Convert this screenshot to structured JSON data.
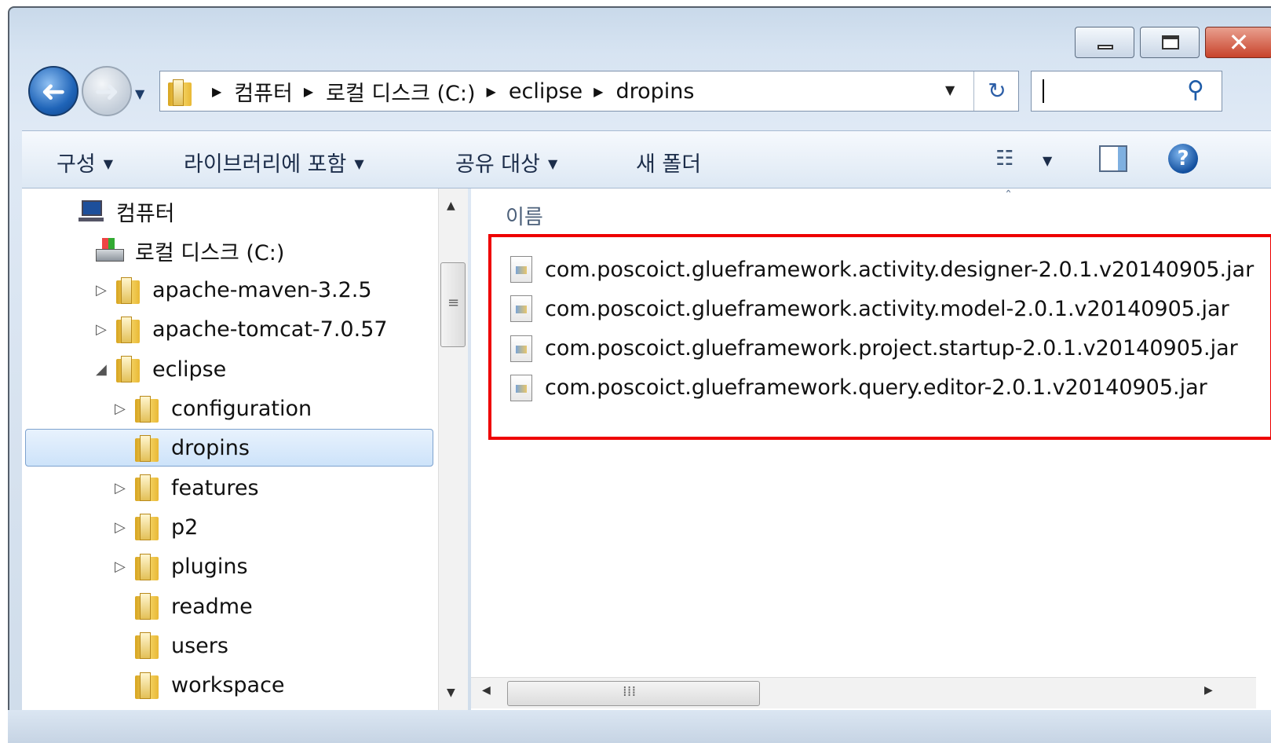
{
  "window": {
    "caption_buttons": {
      "close_glyph": "✕"
    }
  },
  "nav": {
    "back_glyph": "➜",
    "forward_glyph": "➜",
    "history_dropdown_glyph": "▼"
  },
  "address": {
    "breadcrumbs": [
      "컴퓨터",
      "로컬 디스크 (C:)",
      "eclipse",
      "dropins"
    ],
    "separator_glyph": "▶",
    "dropdown_glyph": "▼",
    "refresh_glyph": "↻"
  },
  "search": {
    "value": "",
    "icon_glyph": "⚲"
  },
  "toolbar": {
    "organize": "구성",
    "include_library": "라이브러리에 포함",
    "share_with": "공유 대상",
    "new_folder": "새 폴더",
    "dropdown_glyph": "▼",
    "view_icon_glyph": "☷",
    "help_glyph": "?"
  },
  "tree": {
    "items": [
      {
        "label": "컴퓨터",
        "level": 0,
        "icon": "computer-icon",
        "expander": ""
      },
      {
        "label": "로컬 디스크 (C:)",
        "level": 1,
        "icon": "drive-icon",
        "expander": ""
      },
      {
        "label": "apache-maven-3.2.5",
        "level": 2,
        "icon": "folder-icon",
        "expander": "▷"
      },
      {
        "label": "apache-tomcat-7.0.57",
        "level": 2,
        "icon": "folder-icon",
        "expander": "▷"
      },
      {
        "label": "eclipse",
        "level": 2,
        "icon": "folder-icon",
        "expander": "◢"
      },
      {
        "label": "configuration",
        "level": 3,
        "icon": "folder-icon",
        "expander": "▷"
      },
      {
        "label": "dropins",
        "level": 3,
        "icon": "folder-icon",
        "expander": "",
        "selected": true
      },
      {
        "label": "features",
        "level": 3,
        "icon": "folder-icon",
        "expander": "▷"
      },
      {
        "label": "p2",
        "level": 3,
        "icon": "folder-icon",
        "expander": "▷"
      },
      {
        "label": "plugins",
        "level": 3,
        "icon": "folder-icon",
        "expander": "▷"
      },
      {
        "label": "readme",
        "level": 3,
        "icon": "folder-icon",
        "expander": ""
      },
      {
        "label": "users",
        "level": 3,
        "icon": "folder-icon",
        "expander": ""
      },
      {
        "label": "workspace",
        "level": 3,
        "icon": "folder-icon",
        "expander": ""
      }
    ],
    "scroll_up_glyph": "▲",
    "scroll_down_glyph": "▼",
    "thumb_grip_glyph": "≡"
  },
  "content": {
    "column_name": "이름",
    "sort_glyph": "ˆ",
    "files": [
      "com.poscoict.glueframework.activity.designer-2.0.1.v20140905.jar",
      "com.poscoict.glueframework.activity.model-2.0.1.v20140905.jar",
      "com.poscoict.glueframework.project.startup-2.0.1.v20140905.jar",
      "com.poscoict.glueframework.query.editor-2.0.1.v20140905.jar"
    ],
    "hscroll_left_glyph": "◀",
    "hscroll_right_glyph": "▶",
    "hscroll_grip_glyph": "⁞⁞⁞"
  },
  "annotation": {
    "highlight_color": "#ee0000"
  }
}
